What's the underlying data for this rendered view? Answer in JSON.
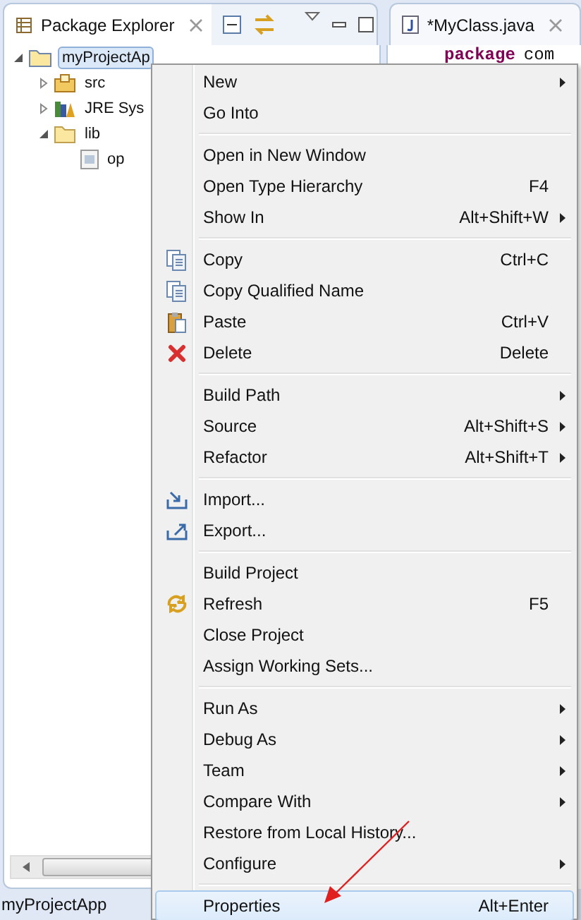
{
  "explorer": {
    "tab": {
      "label": "Package Explorer",
      "selected": true
    },
    "tree": [
      {
        "label": "myProjectAp",
        "expanded": true,
        "selected": true,
        "children": [
          {
            "label": "src",
            "expanded": false
          },
          {
            "label": "JRE Sys",
            "expanded": false
          },
          {
            "label": "lib",
            "expanded": true,
            "children": [
              {
                "label": "op"
              }
            ]
          }
        ]
      }
    ]
  },
  "editor": {
    "tab": {
      "label": "*MyClass.java",
      "selected": false
    },
    "code_keyword": "package",
    "code_text": "com"
  },
  "context_menu": [
    {
      "kind": "item",
      "label": "New",
      "submenu": true,
      "selected": false
    },
    {
      "kind": "item",
      "label": "Go Into",
      "submenu": false,
      "selected": false
    },
    {
      "kind": "separator"
    },
    {
      "kind": "item",
      "label": "Open in New Window",
      "submenu": false,
      "selected": false
    },
    {
      "kind": "item",
      "label": "Open Type Hierarchy",
      "shortcut": "F4",
      "submenu": false,
      "selected": false
    },
    {
      "kind": "item",
      "label": "Show In",
      "shortcut": "Alt+Shift+W",
      "submenu": true,
      "selected": false
    },
    {
      "kind": "separator"
    },
    {
      "kind": "item",
      "label": "Copy",
      "shortcut": "Ctrl+C",
      "submenu": false,
      "selected": false
    },
    {
      "kind": "item",
      "label": "Copy Qualified Name",
      "submenu": false,
      "selected": false
    },
    {
      "kind": "item",
      "label": "Paste",
      "shortcut": "Ctrl+V",
      "submenu": false,
      "selected": false
    },
    {
      "kind": "item",
      "label": "Delete",
      "shortcut": "Delete",
      "submenu": false,
      "selected": false
    },
    {
      "kind": "separator"
    },
    {
      "kind": "item",
      "label": "Build Path",
      "submenu": true,
      "selected": false
    },
    {
      "kind": "item",
      "label": "Source",
      "shortcut": "Alt+Shift+S",
      "submenu": true,
      "selected": false
    },
    {
      "kind": "item",
      "label": "Refactor",
      "shortcut": "Alt+Shift+T",
      "submenu": true,
      "selected": false
    },
    {
      "kind": "separator"
    },
    {
      "kind": "item",
      "label": "Import...",
      "submenu": false,
      "selected": false
    },
    {
      "kind": "item",
      "label": "Export...",
      "submenu": false,
      "selected": false
    },
    {
      "kind": "separator"
    },
    {
      "kind": "item",
      "label": "Build Project",
      "submenu": false,
      "selected": false
    },
    {
      "kind": "item",
      "label": "Refresh",
      "shortcut": "F5",
      "submenu": false,
      "selected": false
    },
    {
      "kind": "item",
      "label": "Close Project",
      "submenu": false,
      "selected": false
    },
    {
      "kind": "item",
      "label": "Assign Working Sets...",
      "submenu": false,
      "selected": false
    },
    {
      "kind": "separator"
    },
    {
      "kind": "item",
      "label": "Run As",
      "submenu": true,
      "selected": false
    },
    {
      "kind": "item",
      "label": "Debug As",
      "submenu": true,
      "selected": false
    },
    {
      "kind": "item",
      "label": "Team",
      "submenu": true,
      "selected": false
    },
    {
      "kind": "item",
      "label": "Compare With",
      "submenu": true,
      "selected": false
    },
    {
      "kind": "item",
      "label": "Restore from Local History...",
      "submenu": false,
      "selected": false
    },
    {
      "kind": "item",
      "label": "Configure",
      "submenu": true,
      "selected": false
    },
    {
      "kind": "separator"
    },
    {
      "kind": "item",
      "label": "Properties",
      "shortcut": "Alt+Enter",
      "submenu": false,
      "selected": true
    }
  ],
  "status_bar": "myProjectApp"
}
